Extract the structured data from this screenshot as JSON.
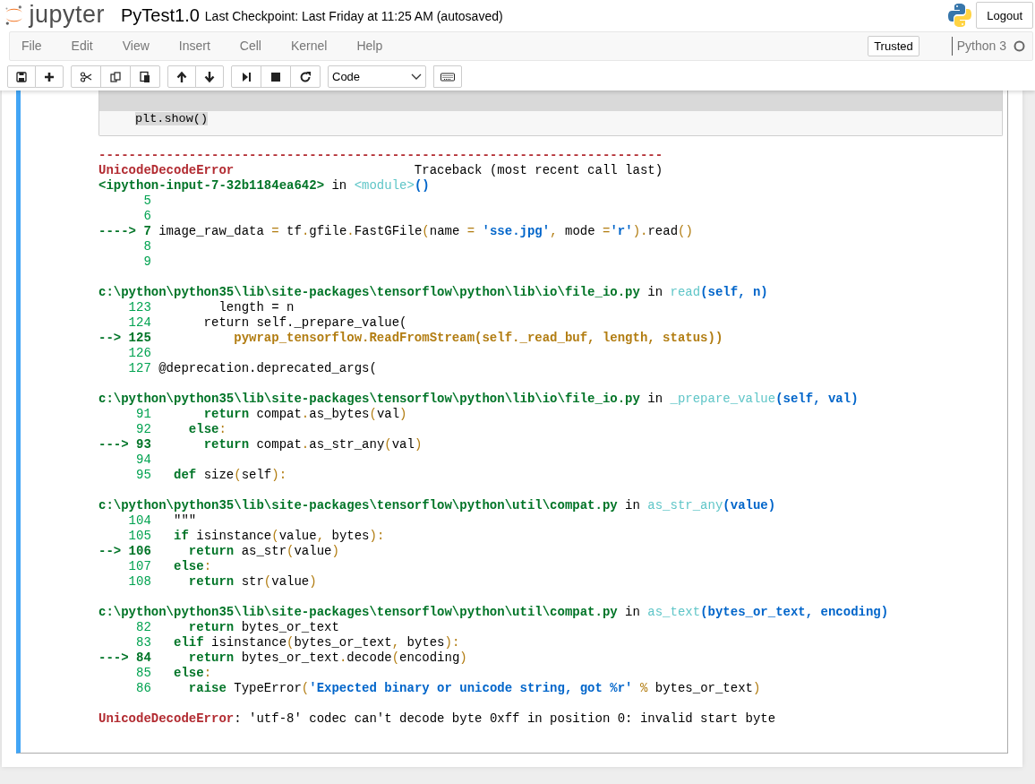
{
  "header": {
    "logo_text": "jupyter",
    "notebook_name": "PyTest1.0",
    "checkpoint": "Last Checkpoint: Last Friday at 11:25 AM (autosaved)",
    "logout": "Logout"
  },
  "menubar": {
    "items": [
      "File",
      "Edit",
      "View",
      "Insert",
      "Cell",
      "Kernel",
      "Help"
    ],
    "trusted": "Trusted",
    "kernel_name": "Python 3",
    "kernel_busy": false
  },
  "toolbar": {
    "groups": [
      [
        {
          "kind": "save"
        },
        {
          "kind": "insert"
        }
      ],
      [
        {
          "kind": "cut"
        },
        {
          "kind": "copy"
        },
        {
          "kind": "paste"
        }
      ],
      [
        {
          "kind": "up"
        },
        {
          "kind": "down"
        }
      ],
      [
        {
          "kind": "run"
        },
        {
          "kind": "stop"
        },
        {
          "kind": "restart"
        }
      ]
    ],
    "cell_type": "Code",
    "extra": [
      {
        "kind": "keyboard"
      }
    ]
  },
  "cell": {
    "selected": true,
    "code_lines": [
      {
        "text": "plt.show()",
        "highlighted": true
      }
    ],
    "traceback": [
      [
        [
          {
            "kind": "error",
            "text": "---------------------------------------------------------------------------"
          }
        ],
        [
          {
            "kind": "error",
            "text": "UnicodeDecodeError"
          },
          {
            "kind": "plain",
            "text": "                        Traceback (most recent call last)"
          }
        ],
        [
          {
            "kind": "location",
            "text": "<ipython-input-7-32b1184ea642>"
          },
          {
            "kind": "plain",
            "text": " in "
          },
          {
            "kind": "function",
            "text": "<module>"
          },
          {
            "kind": "args",
            "text": "()"
          }
        ],
        [
          {
            "kind": "lineno",
            "text": "      5"
          }
        ],
        [
          {
            "kind": "lineno",
            "text": "      6"
          }
        ],
        [
          {
            "kind": "current",
            "text": "----> 7 "
          },
          {
            "kind": "plain",
            "text": "image_raw_data "
          },
          {
            "kind": "punct",
            "text": "="
          },
          {
            "kind": "plain",
            "text": " tf"
          },
          {
            "kind": "punct",
            "text": "."
          },
          {
            "kind": "plain",
            "text": "gfile"
          },
          {
            "kind": "punct",
            "text": "."
          },
          {
            "kind": "plain",
            "text": "FastGFile"
          },
          {
            "kind": "punct",
            "text": "("
          },
          {
            "kind": "plain",
            "text": "name "
          },
          {
            "kind": "punct",
            "text": "="
          },
          {
            "kind": "string",
            "text": " 'sse.jpg'"
          },
          {
            "kind": "punct",
            "text": ","
          },
          {
            "kind": "plain",
            "text": " mode "
          },
          {
            "kind": "punct",
            "text": "="
          },
          {
            "kind": "string",
            "text": "'r'"
          },
          {
            "kind": "punct",
            "text": ")."
          },
          {
            "kind": "plain",
            "text": "read"
          },
          {
            "kind": "punct",
            "text": "()"
          }
        ],
        [
          {
            "kind": "lineno",
            "text": "      8"
          }
        ],
        [
          {
            "kind": "lineno",
            "text": "      9"
          }
        ]
      ],
      [
        [
          {
            "kind": "location",
            "text": "c:\\python\\python35\\lib\\site-packages\\tensorflow\\python\\lib\\io\\file_io.py"
          },
          {
            "kind": "plain",
            "text": " in "
          },
          {
            "kind": "function",
            "text": "read"
          },
          {
            "kind": "args",
            "text": "(self, n)"
          }
        ],
        [
          {
            "kind": "lineno",
            "text": "    123"
          },
          {
            "kind": "plain",
            "text": "         length = n"
          }
        ],
        [
          {
            "kind": "lineno",
            "text": "    124"
          },
          {
            "kind": "plain",
            "text": "       return self._prepare_value("
          }
        ],
        [
          {
            "kind": "current",
            "text": "--> 125"
          },
          {
            "kind": "call",
            "text": "           pywrap_tensorflow.ReadFromStream(self._read_buf, length, status))"
          }
        ],
        [
          {
            "kind": "lineno",
            "text": "    126"
          }
        ],
        [
          {
            "kind": "lineno",
            "text": "    127"
          },
          {
            "kind": "plain",
            "text": " @deprecation.deprecated_args("
          }
        ]
      ],
      [
        [
          {
            "kind": "location",
            "text": "c:\\python\\python35\\lib\\site-packages\\tensorflow\\python\\lib\\io\\file_io.py"
          },
          {
            "kind": "plain",
            "text": " in "
          },
          {
            "kind": "function",
            "text": "_prepare_value"
          },
          {
            "kind": "args",
            "text": "(self, val)"
          }
        ],
        [
          {
            "kind": "lineno",
            "text": "     91       "
          },
          {
            "kind": "keyword",
            "text": "return"
          },
          {
            "kind": "plain",
            "text": " compat"
          },
          {
            "kind": "punct",
            "text": "."
          },
          {
            "kind": "plain",
            "text": "as_bytes"
          },
          {
            "kind": "punct",
            "text": "("
          },
          {
            "kind": "plain",
            "text": "val"
          },
          {
            "kind": "punct",
            "text": ")"
          }
        ],
        [
          {
            "kind": "lineno",
            "text": "     92     "
          },
          {
            "kind": "keyword",
            "text": "else"
          },
          {
            "kind": "punct",
            "text": ":"
          }
        ],
        [
          {
            "kind": "current",
            "text": "---> 93       "
          },
          {
            "kind": "keyword",
            "text": "return"
          },
          {
            "kind": "plain",
            "text": " compat"
          },
          {
            "kind": "punct",
            "text": "."
          },
          {
            "kind": "plain",
            "text": "as_str_any"
          },
          {
            "kind": "punct",
            "text": "("
          },
          {
            "kind": "plain",
            "text": "val"
          },
          {
            "kind": "punct",
            "text": ")"
          }
        ],
        [
          {
            "kind": "lineno",
            "text": "     94"
          }
        ],
        [
          {
            "kind": "lineno",
            "text": "     95   "
          },
          {
            "kind": "keyword",
            "text": "def"
          },
          {
            "kind": "plain",
            "text": " size"
          },
          {
            "kind": "punct",
            "text": "("
          },
          {
            "kind": "plain",
            "text": "self"
          },
          {
            "kind": "punct",
            "text": "):"
          }
        ]
      ],
      [
        [
          {
            "kind": "location",
            "text": "c:\\python\\python35\\lib\\site-packages\\tensorflow\\python\\util\\compat.py"
          },
          {
            "kind": "plain",
            "text": " in "
          },
          {
            "kind": "function",
            "text": "as_str_any"
          },
          {
            "kind": "args",
            "text": "(value)"
          }
        ],
        [
          {
            "kind": "lineno",
            "text": "    104"
          },
          {
            "kind": "plain",
            "text": "   \"\"\""
          }
        ],
        [
          {
            "kind": "lineno",
            "text": "    105   "
          },
          {
            "kind": "keyword",
            "text": "if"
          },
          {
            "kind": "plain",
            "text": " isinstance"
          },
          {
            "kind": "punct",
            "text": "("
          },
          {
            "kind": "plain",
            "text": "value"
          },
          {
            "kind": "punct",
            "text": ","
          },
          {
            "kind": "plain",
            "text": " bytes"
          },
          {
            "kind": "punct",
            "text": "):"
          }
        ],
        [
          {
            "kind": "current",
            "text": "--> 106     "
          },
          {
            "kind": "keyword",
            "text": "return"
          },
          {
            "kind": "plain",
            "text": " as_str"
          },
          {
            "kind": "punct",
            "text": "("
          },
          {
            "kind": "plain",
            "text": "value"
          },
          {
            "kind": "punct",
            "text": ")"
          }
        ],
        [
          {
            "kind": "lineno",
            "text": "    107   "
          },
          {
            "kind": "keyword",
            "text": "else"
          },
          {
            "kind": "punct",
            "text": ":"
          }
        ],
        [
          {
            "kind": "lineno",
            "text": "    108     "
          },
          {
            "kind": "keyword",
            "text": "return"
          },
          {
            "kind": "plain",
            "text": " str"
          },
          {
            "kind": "punct",
            "text": "("
          },
          {
            "kind": "plain",
            "text": "value"
          },
          {
            "kind": "punct",
            "text": ")"
          }
        ]
      ],
      [
        [
          {
            "kind": "location",
            "text": "c:\\python\\python35\\lib\\site-packages\\tensorflow\\python\\util\\compat.py"
          },
          {
            "kind": "plain",
            "text": " in "
          },
          {
            "kind": "function",
            "text": "as_text"
          },
          {
            "kind": "args",
            "text": "(bytes_or_text, encoding)"
          }
        ],
        [
          {
            "kind": "lineno",
            "text": "     82     "
          },
          {
            "kind": "keyword",
            "text": "return"
          },
          {
            "kind": "plain",
            "text": " bytes_or_text"
          }
        ],
        [
          {
            "kind": "lineno",
            "text": "     83   "
          },
          {
            "kind": "keyword",
            "text": "elif"
          },
          {
            "kind": "plain",
            "text": " isinstance"
          },
          {
            "kind": "punct",
            "text": "("
          },
          {
            "kind": "plain",
            "text": "bytes_or_text"
          },
          {
            "kind": "punct",
            "text": ","
          },
          {
            "kind": "plain",
            "text": " bytes"
          },
          {
            "kind": "punct",
            "text": "):"
          }
        ],
        [
          {
            "kind": "current",
            "text": "---> 84     "
          },
          {
            "kind": "keyword",
            "text": "return"
          },
          {
            "kind": "plain",
            "text": " bytes_or_text"
          },
          {
            "kind": "punct",
            "text": "."
          },
          {
            "kind": "plain",
            "text": "decode"
          },
          {
            "kind": "punct",
            "text": "("
          },
          {
            "kind": "plain",
            "text": "encoding"
          },
          {
            "kind": "punct",
            "text": ")"
          }
        ],
        [
          {
            "kind": "lineno",
            "text": "     85   "
          },
          {
            "kind": "keyword",
            "text": "else"
          },
          {
            "kind": "punct",
            "text": ":"
          }
        ],
        [
          {
            "kind": "lineno",
            "text": "     86     "
          },
          {
            "kind": "keyword",
            "text": "raise"
          },
          {
            "kind": "plain",
            "text": " TypeError"
          },
          {
            "kind": "punct",
            "text": "("
          },
          {
            "kind": "string",
            "text": "'Expected binary or unicode string, got %r'"
          },
          {
            "kind": "punct",
            "text": " %"
          },
          {
            "kind": "plain",
            "text": " bytes_or_text"
          },
          {
            "kind": "punct",
            "text": ")"
          }
        ]
      ],
      [
        [
          {
            "kind": "error",
            "text": "UnicodeDecodeError"
          },
          {
            "kind": "plain",
            "text": ": 'utf-8' codec can't decode byte 0xff in position 0: invalid start byte"
          }
        ]
      ]
    ]
  }
}
